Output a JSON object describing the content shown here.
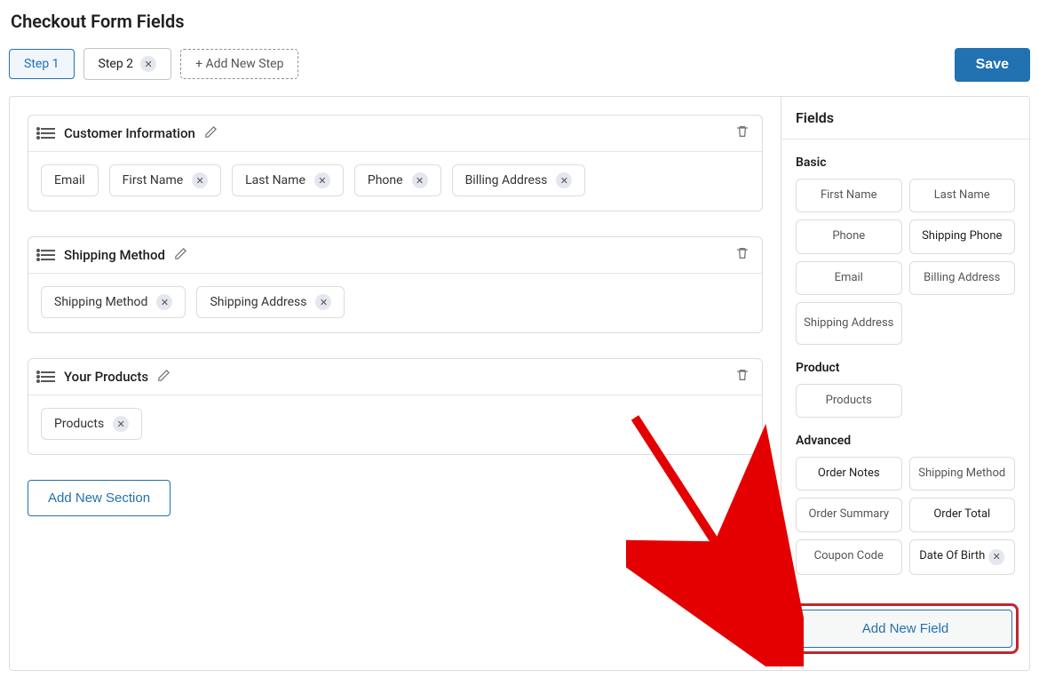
{
  "page": {
    "title": "Checkout Form Fields",
    "save": "Save"
  },
  "steps": {
    "items": [
      "Step 1",
      "Step 2"
    ],
    "active": 0,
    "add_label": "+ Add New Step"
  },
  "sections": [
    {
      "title": "Customer Information",
      "fields": [
        {
          "label": "Email",
          "removable": false
        },
        {
          "label": "First Name",
          "removable": true
        },
        {
          "label": "Last Name",
          "removable": true
        },
        {
          "label": "Phone",
          "removable": true
        },
        {
          "label": "Billing Address",
          "removable": true
        }
      ]
    },
    {
      "title": "Shipping Method",
      "fields": [
        {
          "label": "Shipping Method",
          "removable": true
        },
        {
          "label": "Shipping Address",
          "removable": true
        }
      ]
    },
    {
      "title": "Your Products",
      "fields": [
        {
          "label": "Products",
          "removable": true
        }
      ]
    }
  ],
  "add_section": "Add New Section",
  "sidebar": {
    "title": "Fields",
    "groups": [
      {
        "title": "Basic",
        "items": [
          {
            "label": "First Name",
            "disabled": true
          },
          {
            "label": "Last Name",
            "disabled": true
          },
          {
            "label": "Phone",
            "disabled": true
          },
          {
            "label": "Shipping Phone",
            "disabled": false
          },
          {
            "label": "Email",
            "disabled": true
          },
          {
            "label": "Billing Address",
            "disabled": true
          },
          {
            "label": "Shipping Address",
            "disabled": true,
            "tall": true
          }
        ]
      },
      {
        "title": "Product",
        "items": [
          {
            "label": "Products",
            "disabled": true
          }
        ]
      },
      {
        "title": "Advanced",
        "items": [
          {
            "label": "Order Notes",
            "disabled": false
          },
          {
            "label": "Shipping Method",
            "disabled": true
          },
          {
            "label": "Order Summary",
            "disabled": true
          },
          {
            "label": "Order Total",
            "disabled": false
          },
          {
            "label": "Coupon Code",
            "disabled": true
          },
          {
            "label": "Date Of Birth",
            "disabled": false,
            "removable": true
          }
        ]
      }
    ],
    "add_field": "Add New Field"
  }
}
